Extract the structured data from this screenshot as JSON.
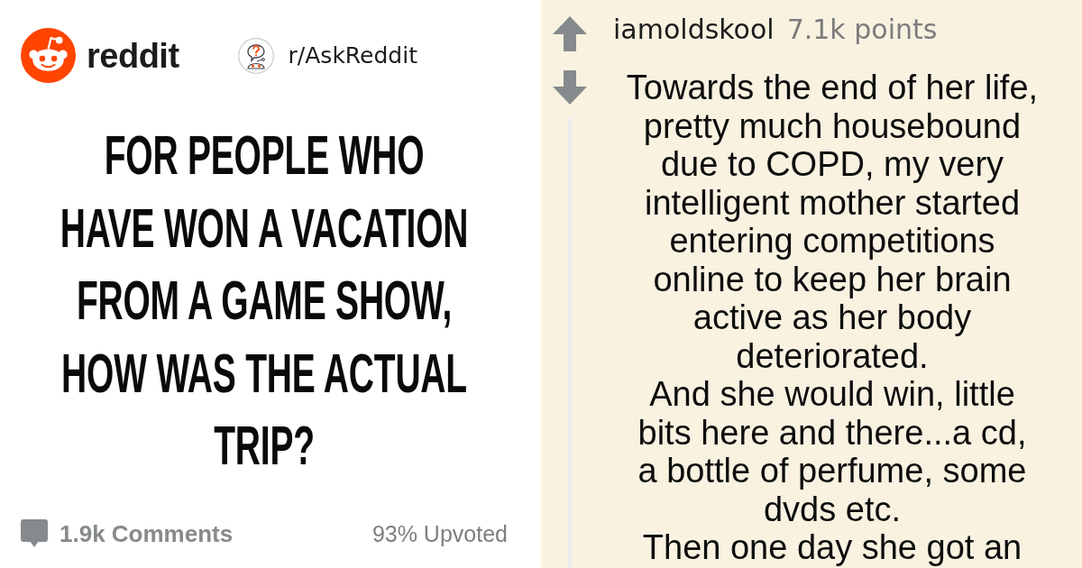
{
  "post": {
    "site": {
      "wordmark": "reddit"
    },
    "subreddit": "r/AskReddit",
    "title_lines": [
      "FOR PEOPLE WHO",
      "HAVE WON A VACATION",
      "FROM A GAME SHOW,",
      "HOW WAS THE ACTUAL",
      "TRIP?"
    ],
    "comments": "1.9k Comments",
    "upvoted": "93% Upvoted"
  },
  "comment": {
    "author": "iamoldskool",
    "points": "7.1k points",
    "paragraphs": [
      {
        "lines": [
          "Towards the end of her life,",
          "pretty much housebound",
          "due to COPD, my very",
          "intelligent mother started",
          "entering competitions",
          "online to keep her brain",
          "active as her body",
          "deteriorated."
        ]
      },
      {
        "lines": [
          "And she would win, little",
          "bits here and there...a cd,",
          "a bottle of perfume, some",
          "dvds etc."
        ]
      },
      {
        "lines": [
          "Then one day she got an"
        ]
      }
    ]
  }
}
